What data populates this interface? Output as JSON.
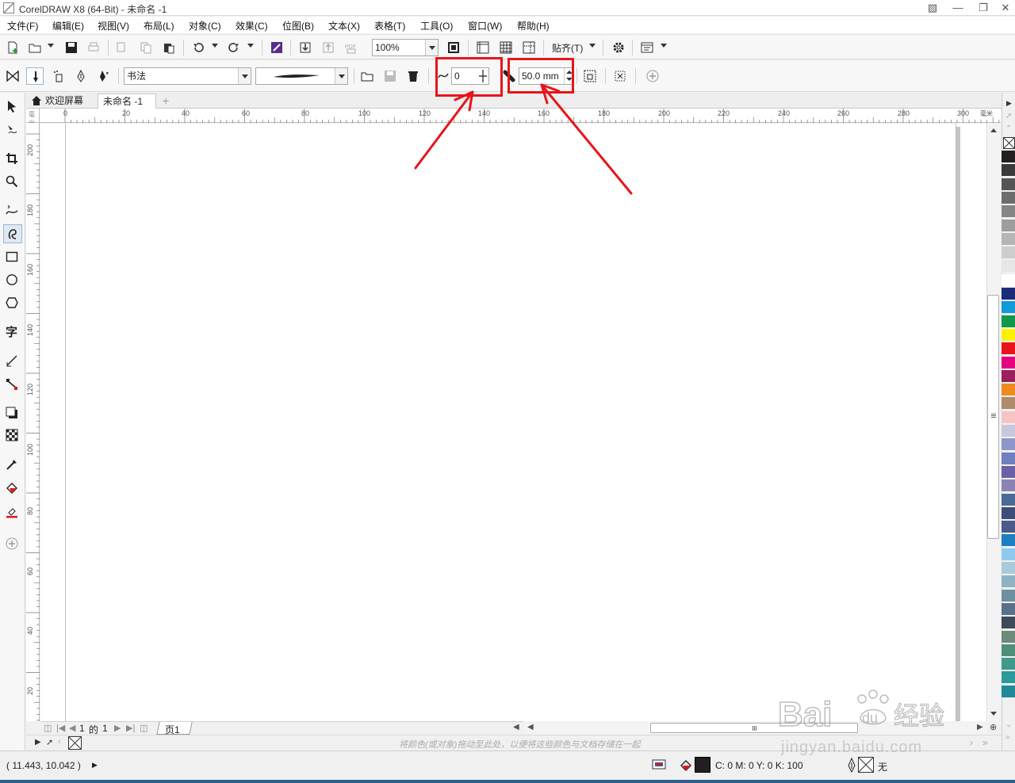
{
  "window": {
    "title": "CorelDRAW X8 (64-Bit) - 未命名 -1"
  },
  "menu": [
    "文件(F)",
    "编辑(E)",
    "视图(V)",
    "布局(L)",
    "对象(C)",
    "效果(C)",
    "位图(B)",
    "文本(X)",
    "表格(T)",
    "工具(O)",
    "窗口(W)",
    "帮助(H)"
  ],
  "toolbar": {
    "zoom": "100%",
    "snap_label": "贴齐(T)"
  },
  "property_bar": {
    "preset": "书法",
    "smoothing_value": "0",
    "stroke_width_value": "50.0 mm"
  },
  "doc_tabs": {
    "welcome": "欢迎屏幕",
    "document": "未命名 -1"
  },
  "ruler": {
    "horizontal": [
      "0",
      "20",
      "40",
      "60",
      "80",
      "100",
      "120",
      "140",
      "160",
      "180",
      "200",
      "220",
      "240",
      "260",
      "280",
      "300"
    ],
    "vertical": [
      "200",
      "180",
      "160",
      "140",
      "120",
      "100",
      "80",
      "60",
      "40",
      "20"
    ],
    "units_h": "毫米",
    "units_v": "毫米"
  },
  "page_nav": {
    "current": "1",
    "of": "的",
    "total": "1",
    "page_tab": "页1"
  },
  "color_docker_hint": "将颜色(或对象)拖动至此处，以便将这些颜色与文档存储在一起",
  "status": {
    "coords": "( 11.443, 10.042 )",
    "fill_color": "C: 0 M: 0 Y: 0 K: 100",
    "outline": "无"
  },
  "palette_colors": [
    "#231f20",
    "#3a3a3a",
    "#555555",
    "#6d6d6d",
    "#858585",
    "#9d9d9d",
    "#b5b5b5",
    "#cdcdcd",
    "#e6e6e6",
    "#ffffff",
    "#1c2a7a",
    "#0f9ad8",
    "#0c9a4a",
    "#fff200",
    "#e8141b",
    "#e4007f",
    "#9b1f5c",
    "#f08a1c",
    "#b08a6a",
    "#f7c4c4",
    "#c7c7e0",
    "#8f96c9",
    "#6f7fc0",
    "#6c5fa6",
    "#8c83b5",
    "#4a6a9a",
    "#3d4d7a",
    "#4b5a8a",
    "#1b7fc4",
    "#8ec9ee",
    "#a9cbd9",
    "#8fb2c2",
    "#6e8fa0",
    "#59718a",
    "#3c4a5a",
    "#6d8a7a",
    "#4f8f7a",
    "#3d9a8a",
    "#2a9a9a",
    "#1f8a9a"
  ],
  "brand": {
    "highlight_red": "#e8141b"
  },
  "watermark": {
    "logo": "Bai du 经验",
    "url": "jingyan.baidu.com"
  }
}
